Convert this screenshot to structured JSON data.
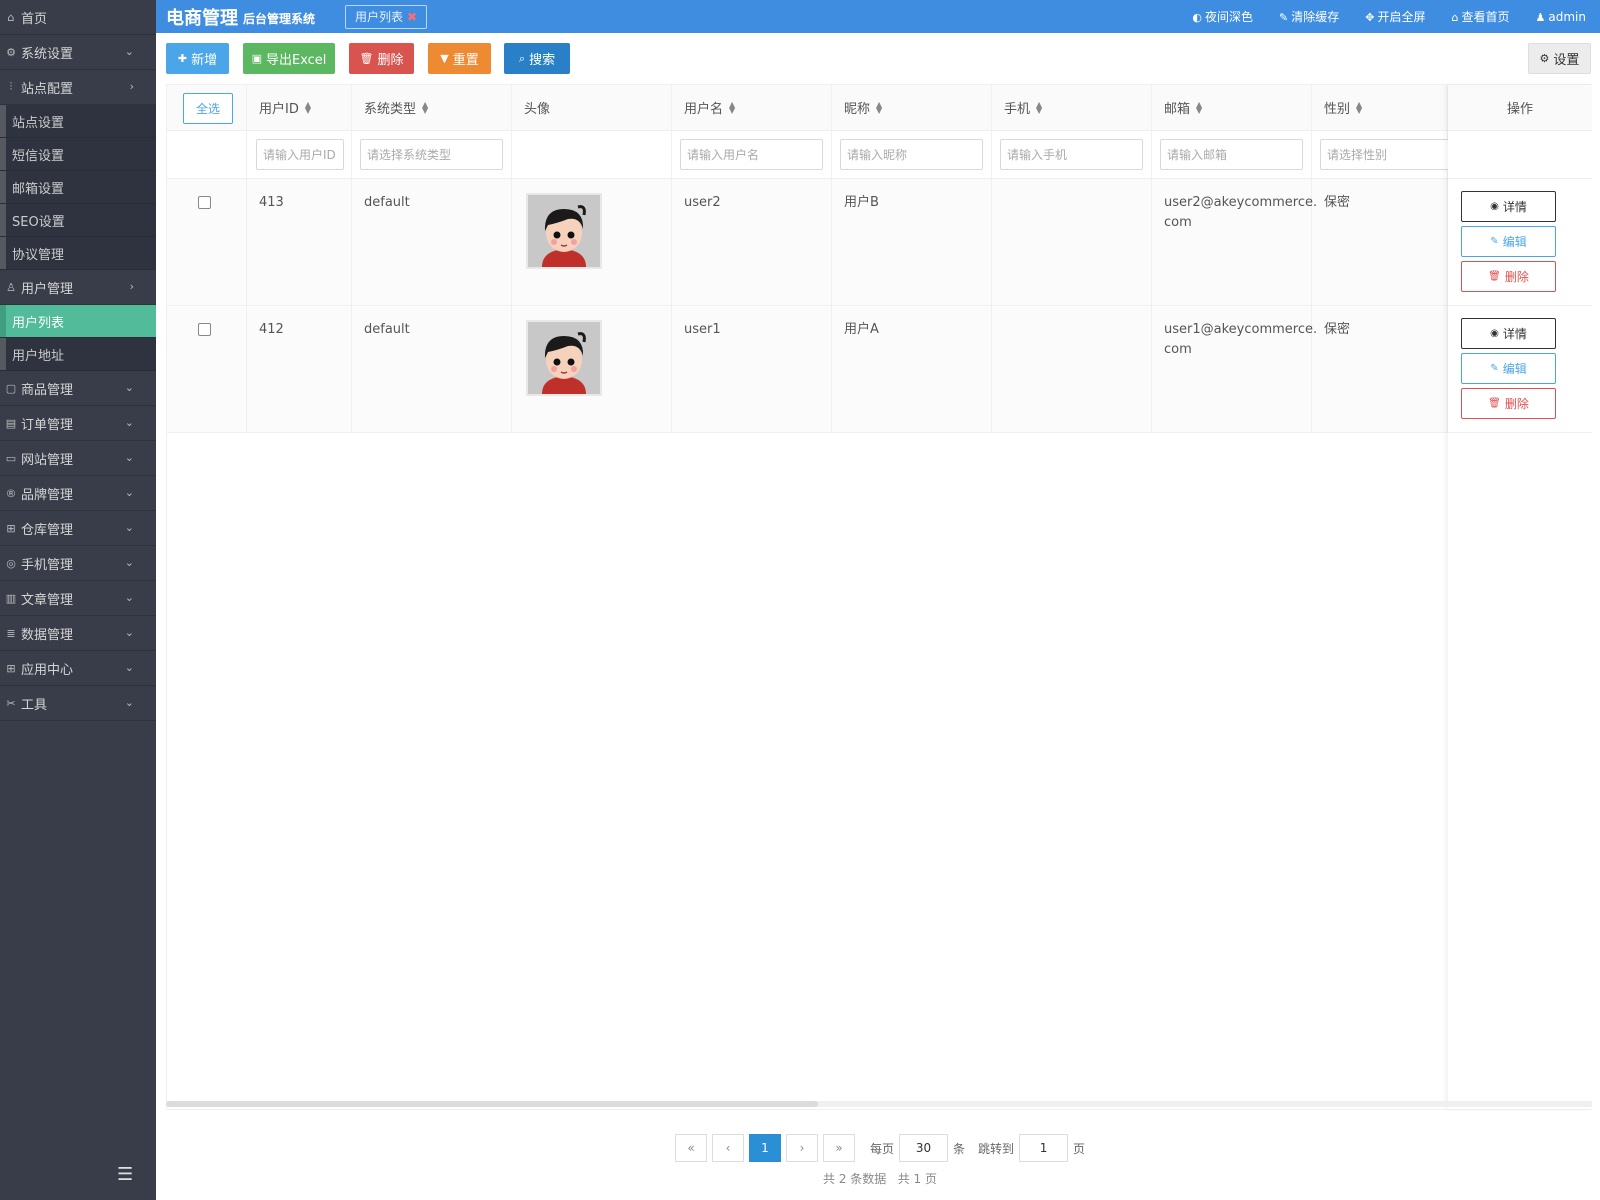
{
  "app": {
    "brand": "电商管理",
    "brand_sub": "后台管理系统",
    "open_tab": "用户列表"
  },
  "topbar": {
    "actions": [
      {
        "label": "夜间深色",
        "icon": "half-circle-icon"
      },
      {
        "label": "清除缓存",
        "icon": "brush-icon"
      },
      {
        "label": "开启全屏",
        "icon": "fullscreen-icon"
      },
      {
        "label": "查看首页",
        "icon": "home-icon"
      },
      {
        "label": "admin",
        "icon": "user-icon"
      }
    ]
  },
  "sidebar": {
    "home": "首页",
    "system_settings": "系统设置",
    "site_config": "站点配置",
    "site_config_items": [
      "站点设置",
      "短信设置",
      "邮箱设置",
      "SEO设置",
      "协议管理"
    ],
    "user_mgmt": "用户管理",
    "user_mgmt_items": [
      "用户列表",
      "用户地址"
    ],
    "groups": [
      "商品管理",
      "订单管理",
      "网站管理",
      "品牌管理",
      "仓库管理",
      "手机管理",
      "文章管理",
      "数据管理",
      "应用中心",
      "工具"
    ]
  },
  "toolbar": {
    "add": "新增",
    "export": "导出Excel",
    "delete": "删除",
    "reset": "重置",
    "search": "搜索",
    "settings": "设置"
  },
  "table": {
    "select_all": "全选",
    "headers": [
      "用户ID",
      "系统类型",
      "头像",
      "用户名",
      "昵称",
      "手机",
      "邮箱",
      "性别"
    ],
    "actions_header": "操作",
    "placeholders": [
      "请输入用户ID",
      "请选择系统类型",
      "请输入用户名",
      "请输入昵称",
      "请输入手机",
      "请输入邮箱",
      "请选择性别"
    ],
    "rows": [
      {
        "id": "413",
        "system_type": "default",
        "username": "user2",
        "nickname": "用户B",
        "phone": "",
        "email_line1": "user2@akeycommerce.",
        "email_line2": "com",
        "gender": "保密"
      },
      {
        "id": "412",
        "system_type": "default",
        "username": "user1",
        "nickname": "用户A",
        "phone": "",
        "email_line1": "user1@akeycommerce.",
        "email_line2": "com",
        "gender": "保密"
      }
    ],
    "row_actions": {
      "detail": "详情",
      "edit": "编辑",
      "delete": "删除"
    }
  },
  "pagination": {
    "first": "«",
    "prev": "‹",
    "current": "1",
    "next": "›",
    "last": "»",
    "per_page_label": "每页",
    "per_page": "30",
    "per_page_unit": "条",
    "jump_label": "跳转到",
    "jump_page": "1",
    "jump_unit": "页",
    "summary": "共 2 条数据   共 1 页"
  },
  "colors": {
    "topbar": "#3f8de0",
    "sidebar": "#393d49",
    "active_menu": "#52bb9a"
  }
}
